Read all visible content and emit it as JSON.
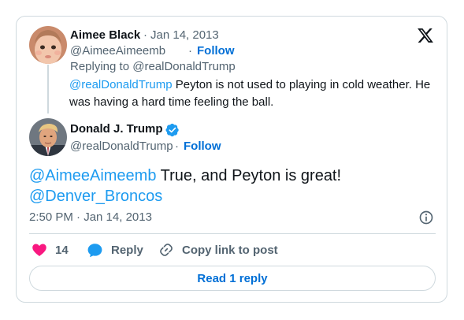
{
  "reply_tweet": {
    "author_name": "Aimee Black",
    "separator": "·",
    "date": "Jan 14, 2013",
    "handle": "@AimeeAimeemb",
    "follow_label": "Follow",
    "replying_to_prefix": "Replying to",
    "replying_to_handle": "@realDonaldTrump",
    "mention": "@realDonaldTrump",
    "text": " Peyton is not used to playing in cold weather.  He was having a hard time feeling the ball."
  },
  "main_tweet": {
    "author_name": "Donald J. Trump",
    "handle": "@realDonaldTrump",
    "separator": "·",
    "follow_label": "Follow",
    "mention_1": "@AimeeAimeemb",
    "text_1": " True, and Peyton is great!",
    "mention_2": "@Denver_Broncos",
    "timestamp": "2:50 PM · Jan 14, 2013"
  },
  "actions": {
    "like_count": "14",
    "reply_label": "Reply",
    "copy_label": "Copy link to post"
  },
  "read_reply_label": "Read 1 reply",
  "icons": {
    "logo": "x-logo-icon",
    "verified": "verified-badge-icon",
    "info": "info-icon",
    "like": "heart-icon",
    "reply": "reply-bubble-icon",
    "copy": "link-icon"
  },
  "colors": {
    "link": "#1d9bf0",
    "follow": "#006fd6",
    "heart": "#f91880",
    "muted": "#536471",
    "border": "#cfd9de"
  }
}
